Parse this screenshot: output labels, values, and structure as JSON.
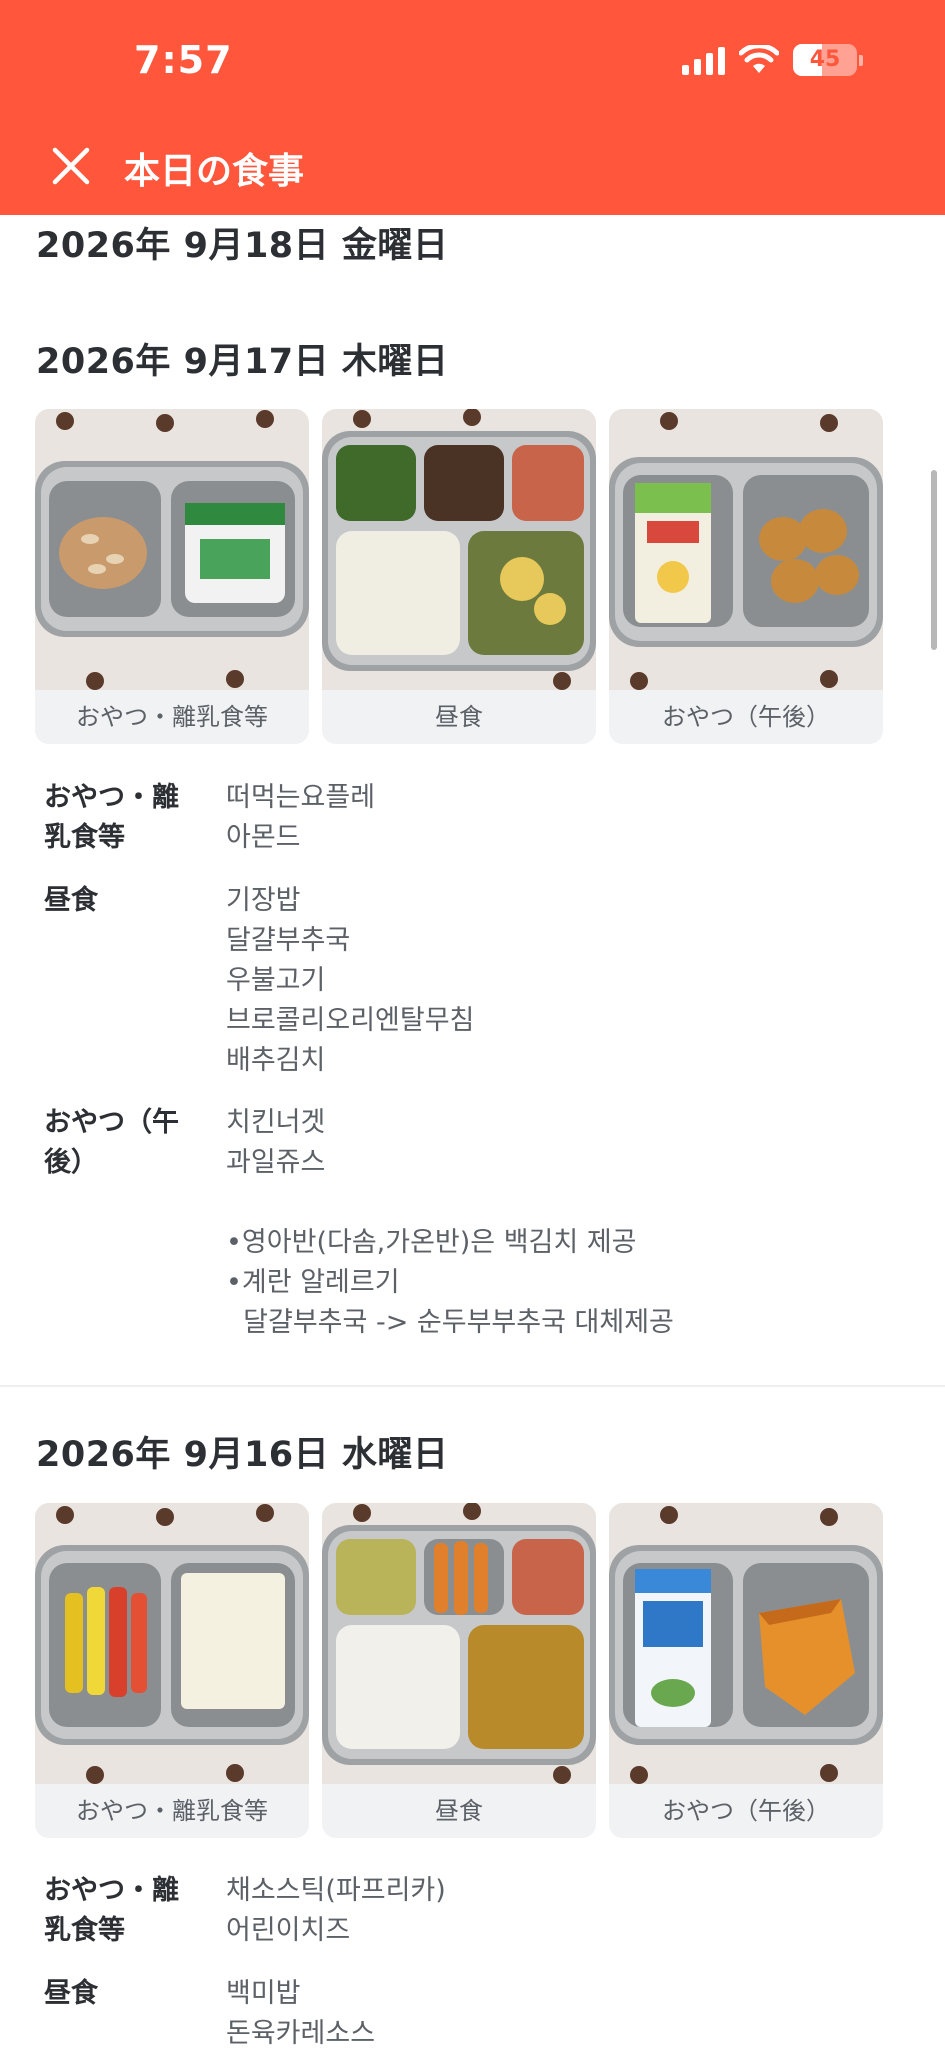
{
  "status_bar": {
    "time": "7:57",
    "battery": "45"
  },
  "header": {
    "title": "本日の食事"
  },
  "days": [
    {
      "date": "2026年 9月18日 金曜日"
    },
    {
      "date": "2026年 9月17日 木曜日",
      "photos": [
        {
          "label": "おやつ・離乳食等"
        },
        {
          "label": "昼食"
        },
        {
          "label": "おやつ（午後）"
        }
      ],
      "meals": [
        {
          "name": "おやつ・離\n乳食等",
          "items": "떠먹는요플레\n아몬드"
        },
        {
          "name": "昼食",
          "items": "기장밥\n달걀부추국\n우불고기\n브로콜리오리엔탈무침\n배추김치"
        },
        {
          "name": "おやつ（午\n後）",
          "items": "치킨너겟\n과일쥬스\n\n•영아반(다솜,가온반)은 백김치 제공\n•계란 알레르기\n  달걀부추국 -> 순두부부추국 대체제공"
        }
      ]
    },
    {
      "date": "2026年 9月16日 水曜日",
      "photos": [
        {
          "label": "おやつ・離乳食等"
        },
        {
          "label": "昼食"
        },
        {
          "label": "おやつ（午後）"
        }
      ],
      "meals": [
        {
          "name": "おやつ・離\n乳食等",
          "items": "채소스틱(파프리카)\n어린이치즈"
        },
        {
          "name": "昼食",
          "items": "백미밥\n돈육카레소스"
        }
      ]
    }
  ]
}
